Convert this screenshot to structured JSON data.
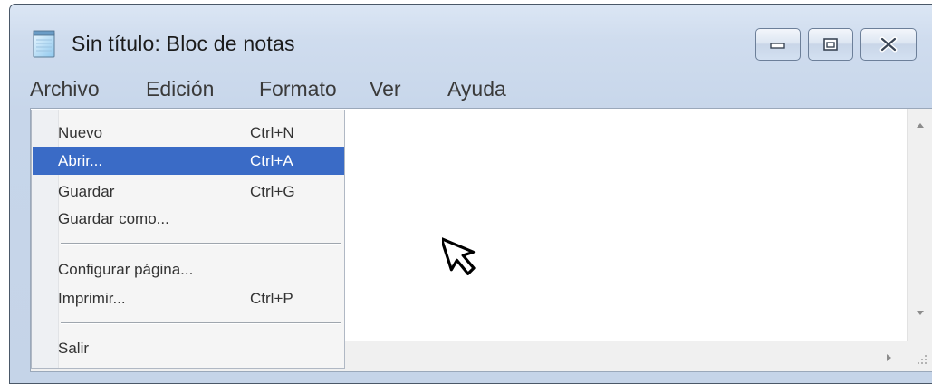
{
  "window": {
    "title": "Sin título: Bloc de notas",
    "app_icon": "notepad-icon",
    "controls": {
      "minimize_icon": "minimize-icon",
      "maximize_icon": "maximize-icon",
      "close_icon": "close-icon"
    }
  },
  "menubar": {
    "items": [
      "Archivo",
      "Edición",
      "Formato",
      "Ver",
      "Ayuda"
    ]
  },
  "file_menu": {
    "items": [
      {
        "label": "Nuevo",
        "shortcut": "Ctrl+N",
        "highlighted": false
      },
      {
        "label": "Abrir...",
        "shortcut": "Ctrl+A",
        "highlighted": true
      },
      {
        "label": "Guardar",
        "shortcut": "Ctrl+G",
        "highlighted": false
      },
      {
        "label": "Guardar como...",
        "shortcut": "",
        "highlighted": false
      },
      {
        "label": "Configurar página...",
        "shortcut": "",
        "highlighted": false
      },
      {
        "label": "Imprimir...",
        "shortcut": "Ctrl+P",
        "highlighted": false
      },
      {
        "label": "Salir",
        "shortcut": "",
        "highlighted": false
      }
    ]
  },
  "colors": {
    "highlight": "#3a6bc6",
    "titlebar": "#cfdcee",
    "menu_background": "#f5f5f5"
  },
  "editor": {
    "content": ""
  }
}
